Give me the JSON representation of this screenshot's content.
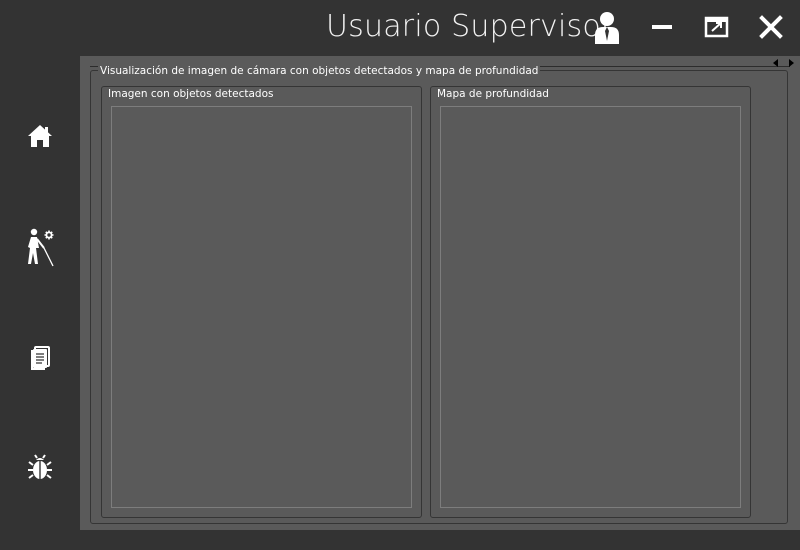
{
  "window": {
    "title": "Usuario Supervisor",
    "icons": {
      "user": "user-icon",
      "minimize": "minimize-icon",
      "maximize": "maximize-icon",
      "close": "close-icon"
    }
  },
  "sidebar": {
    "items": [
      {
        "id": "home",
        "icon": "home-icon"
      },
      {
        "id": "navigation",
        "icon": "blind-person-gear-icon"
      },
      {
        "id": "documents",
        "icon": "document-icon"
      },
      {
        "id": "debug",
        "icon": "bug-icon"
      }
    ]
  },
  "main": {
    "group_title": "Visualización de imagen de cámara con objetos detectados y mapa de profundidad",
    "left_panel": {
      "title": "Imagen con objetos detectados"
    },
    "right_panel": {
      "title": "Mapa de profundidad"
    },
    "tab_scroll": {
      "left_icon": "arrow-left-icon",
      "right_icon": "arrow-right-icon"
    }
  },
  "colors": {
    "window_bg": "#333333",
    "content_bg": "#5a5a5a",
    "text": "#ffffff"
  }
}
